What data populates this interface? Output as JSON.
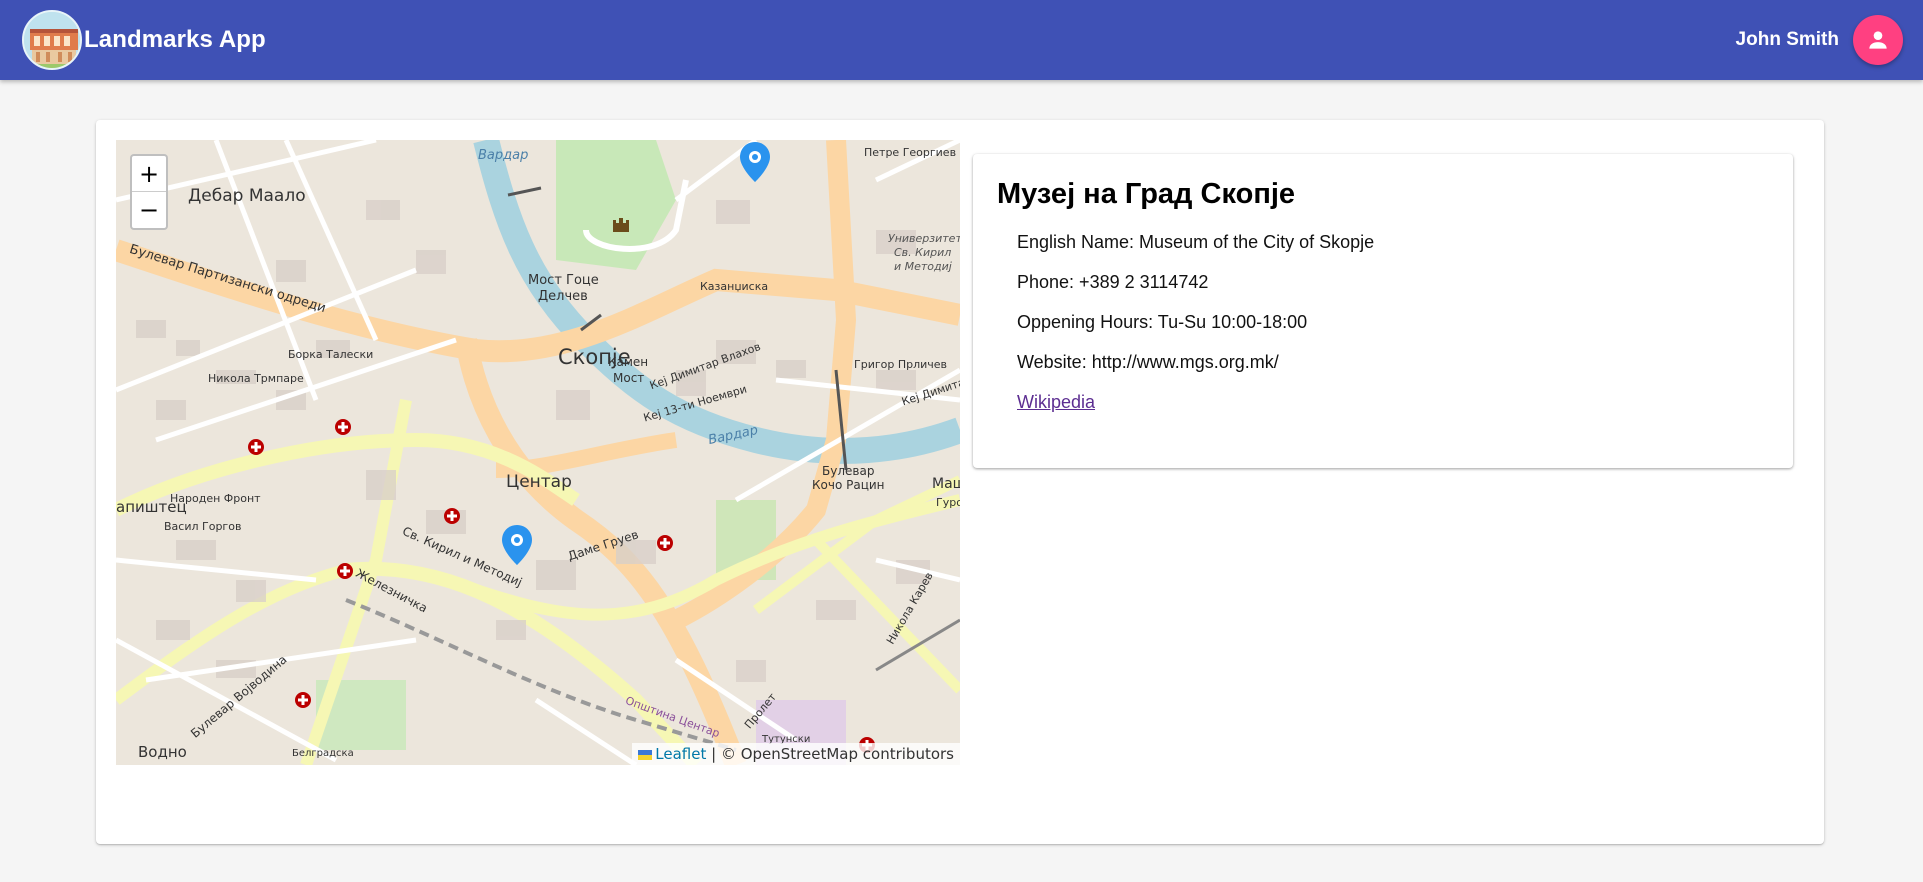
{
  "header": {
    "app_title": "Landmarks App",
    "user_name": "John Smith",
    "logo_icon": "landmark-building-icon",
    "avatar_icon": "person-icon",
    "bar_color": "#3f51b5",
    "avatar_color": "#ff4081"
  },
  "map": {
    "zoom_in_label": "+",
    "zoom_out_label": "−",
    "attribution_leaflet": "Leaflet",
    "attribution_rest": " | © OpenStreetMap contributors",
    "marker_color": "#2a93ee",
    "labels": {
      "city": "Скопје",
      "centar": "Центар",
      "debar_maalo": "Дебар Маало",
      "vardar_top": "Вардар",
      "vardar_right": "Вардар",
      "most_goce": "Мост Гоце",
      "delchev": "Делчев",
      "kamen": "Камен",
      "most": "Мост",
      "bul_partizanski": "Булевар Партизански одреди",
      "bul_kocho_1": "Булевар",
      "bul_kocho_2": "Кочо Рацин",
      "sv_kiril": "Св. Кирил и Методиј",
      "dame_gruev": "Даме Груев",
      "zheleznichka": "Железничка",
      "bul_vojvodina": "Булевар Војводина",
      "vodno": "Водно",
      "pishtec": "апиштец",
      "belgradska": "Белградска",
      "kazanciska": "Казанџиска",
      "nikola_karev": "Никола Карев",
      "prolet": "Пролет",
      "opshtina": "Општина Центар",
      "tutunski": "Тутунски",
      "vasil_glavinov": "Васил Горгов",
      "naroden_front": "Народен Фронт",
      "borka_taleski": "Борка Талески",
      "nikola_trimpare": "Никола Трмпаре",
      "petre_georgiev": "Петре Георгиев",
      "trigor_prlichev": "Григор Прличев",
      "kej_dimitar": "Кеј Димитар Влахов",
      "kej_13": "Кеј 13-ти Ноември",
      "univerzitet": "Универзитет",
      "sv_kiril_short": "Св. Кирил",
      "i_metodij": "и Методиј",
      "kej_dimitar_right": "Кеј Димитар",
      "mak": "Маш",
      "guro": "Гуро"
    }
  },
  "landmark": {
    "title": "Музеј на Град Скопје",
    "english_name": "English Name: Museum of the City of Skopje",
    "phone": "Phone: +389 2 3114742",
    "hours": "Oppening Hours: Tu-Su 10:00-18:00",
    "website": "Website: http://www.mgs.org.mk/",
    "wiki_label": "Wikipedia"
  }
}
